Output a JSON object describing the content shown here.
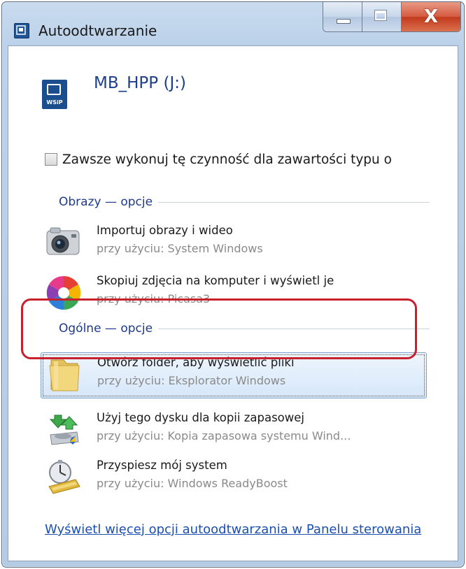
{
  "window": {
    "title": "Autoodtwarzanie",
    "close_glyph": "X"
  },
  "device": {
    "name": "MB_HPP (J:)",
    "icon_tag": "WSiP"
  },
  "always_checkbox": {
    "label": "Zawsze wykonuj tę czynność dla zawartości typu o",
    "checked": false
  },
  "sections": [
    {
      "heading": "Obrazy — opcje",
      "options": [
        {
          "icon": "camera-icon",
          "title": "Importuj obrazy i wideo",
          "subtitle": "przy użyciu: System Windows"
        },
        {
          "icon": "picasa-icon",
          "title": "Skopiuj zdjęcia na komputer i wyświetl je",
          "subtitle": "przy użyciu: Picasa3"
        }
      ]
    },
    {
      "heading": "Ogólne — opcje",
      "options": [
        {
          "icon": "folder-icon",
          "title": "Otwórz folder, aby wyświetlić pliki",
          "subtitle": "przy użyciu: Eksplorator Windows",
          "selected": true
        },
        {
          "icon": "backup-disk-icon",
          "title": "Użyj tego dysku dla kopii zapasowej",
          "subtitle": "przy użyciu: Kopia zapasowa systemu Wind..."
        },
        {
          "icon": "readyboost-icon",
          "title": "Przyspiesz mój system",
          "subtitle": "przy użyciu: Windows ReadyBoost"
        }
      ]
    }
  ],
  "footer_link": "Wyświetl więcej opcji autoodtwarzania w Panelu sterowania",
  "colors": {
    "link": "#1b4fb0",
    "heading": "#1e3a8a",
    "highlight_ring": "#c8202c",
    "selection": "#d6e7fa"
  }
}
